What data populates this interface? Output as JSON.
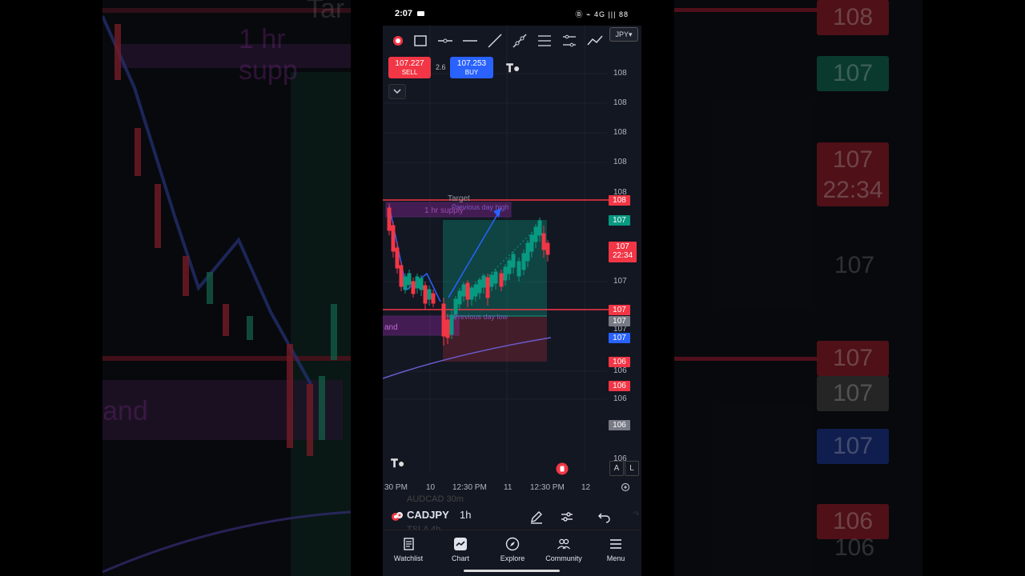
{
  "status": {
    "time": "2:07",
    "icons_text": "Ⓑ ⌁ 4G ||| 88"
  },
  "toolbar": {
    "currency": "JPY"
  },
  "trade": {
    "sell_price": "107.227",
    "sell_label": "SELL",
    "spread": "2.6",
    "buy_price": "107.253",
    "buy_label": "BUY"
  },
  "chart_data": {
    "type": "candlestick",
    "symbol": "CADJPY",
    "timeframe": "1h",
    "y_axis_labels": [
      "108",
      "108",
      "108",
      "108",
      "108",
      "107",
      "107",
      "106",
      "106",
      "106"
    ],
    "x_axis_labels": [
      "30 PM",
      "10",
      "12:30 PM",
      "11",
      "12:30 PM",
      "12"
    ],
    "price_tags": [
      {
        "value": "108",
        "color": "#f23645"
      },
      {
        "value": "107",
        "color": "#089981"
      },
      {
        "value": "107",
        "sub": "22:34",
        "color": "#f23645"
      },
      {
        "value": "107",
        "color": "#f23645"
      },
      {
        "value": "107",
        "color": "#787b86"
      },
      {
        "value": "107",
        "color": "#2962ff"
      },
      {
        "value": "106",
        "color": "#f23645"
      },
      {
        "value": "106",
        "color": "#f23645"
      },
      {
        "value": "106",
        "color": "#787b86"
      }
    ],
    "annotations": [
      "Target",
      "Previous day high",
      "1 hr supply",
      "Previous day low",
      "and"
    ]
  },
  "bottom_controls": {
    "a_label": "A",
    "l_label": "L"
  },
  "symbolbar": {
    "symbol": "CADJPY",
    "timeframe": "1h",
    "ghost_above": "AUDCAD  30m",
    "ghost_below": "TSLA  4h"
  },
  "nav": [
    {
      "label": "Watchlist",
      "icon": "watchlist-icon"
    },
    {
      "label": "Chart",
      "icon": "chart-icon"
    },
    {
      "label": "Explore",
      "icon": "compass-icon"
    },
    {
      "label": "Community",
      "icon": "people-icon"
    },
    {
      "label": "Menu",
      "icon": "menu-icon"
    }
  ],
  "background": {
    "left_text_1": "1 hr supp",
    "left_text_2": "Tar",
    "left_text_3": "and",
    "right_tags": [
      "108",
      "107",
      "107",
      "22:34",
      "107",
      "107",
      "107",
      "107",
      "106",
      "106"
    ]
  }
}
